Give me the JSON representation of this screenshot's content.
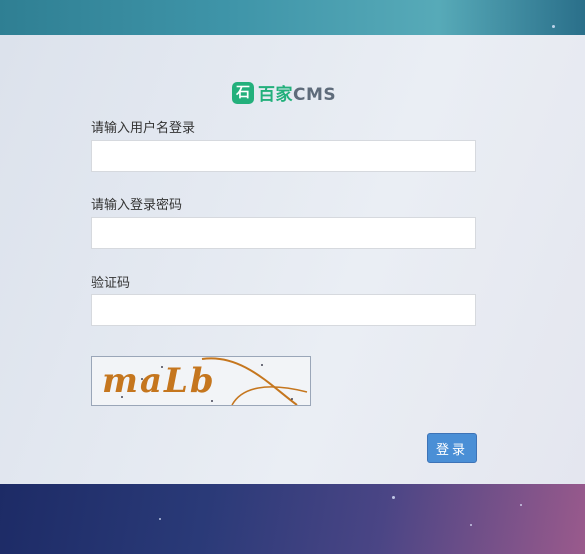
{
  "logo": {
    "icon_glyph": "石",
    "brand_text": "百家",
    "brand_suffix": "CMS",
    "color": "#23b07c"
  },
  "form": {
    "username_label": "请输入用户名登录",
    "username_value": "",
    "password_label": "请输入登录密码",
    "password_value": "",
    "captcha_label": "验证码",
    "captcha_value": "",
    "captcha_image_text": "maLb",
    "login_button": "登录"
  },
  "colors": {
    "accent": "#4a8fd6",
    "captcha_text": "#c5761e"
  }
}
